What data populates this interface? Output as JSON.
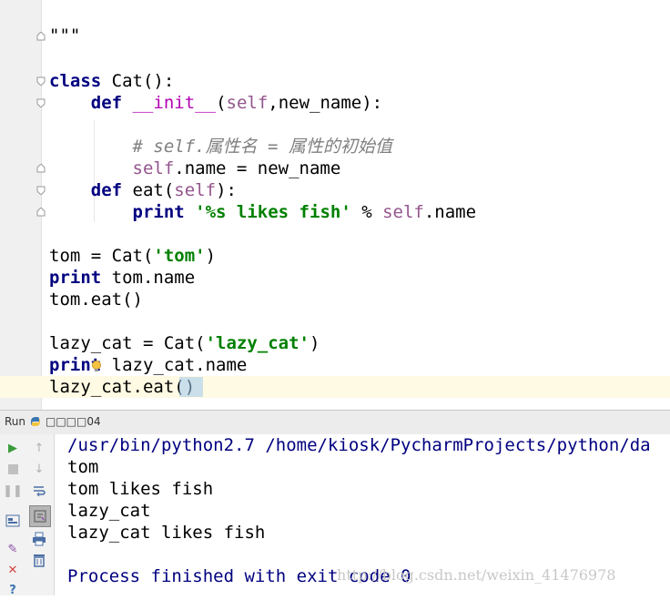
{
  "editor": {
    "lines": [
      {
        "segments": [
          {
            "t": "\"\"\"",
            "c": "plain"
          }
        ]
      },
      {
        "segments": [
          {
            "t": "class",
            "c": "kw"
          },
          {
            "t": " Cat():",
            "c": "plain"
          }
        ]
      },
      {
        "segments": [
          {
            "t": "    ",
            "c": "plain"
          },
          {
            "t": "def",
            "c": "kw"
          },
          {
            "t": " ",
            "c": "plain"
          },
          {
            "t": "__init__",
            "c": "magic"
          },
          {
            "t": "(",
            "c": "plain"
          },
          {
            "t": "self",
            "c": "self"
          },
          {
            "t": ",new_name):",
            "c": "plain"
          }
        ]
      },
      {
        "segments": [
          {
            "t": "        ",
            "c": "plain"
          },
          {
            "t": "# self.属性名 = 属性的初始值",
            "c": "cm"
          }
        ]
      },
      {
        "segments": [
          {
            "t": "        ",
            "c": "plain"
          },
          {
            "t": "self",
            "c": "self"
          },
          {
            "t": ".name = new_name",
            "c": "plain"
          }
        ]
      },
      {
        "segments": [
          {
            "t": "    ",
            "c": "plain"
          },
          {
            "t": "def",
            "c": "kw"
          },
          {
            "t": " eat(",
            "c": "plain"
          },
          {
            "t": "self",
            "c": "self"
          },
          {
            "t": "):",
            "c": "plain"
          }
        ]
      },
      {
        "segments": [
          {
            "t": "        ",
            "c": "plain"
          },
          {
            "t": "print",
            "c": "kw"
          },
          {
            "t": " ",
            "c": "plain"
          },
          {
            "t": "'%s likes fish'",
            "c": "str"
          },
          {
            "t": " % ",
            "c": "plain"
          },
          {
            "t": "self",
            "c": "self"
          },
          {
            "t": ".name",
            "c": "plain"
          }
        ]
      },
      {
        "segments": [
          {
            "t": "tom = Cat(",
            "c": "plain"
          },
          {
            "t": "'tom'",
            "c": "str"
          },
          {
            "t": ")",
            "c": "plain"
          }
        ]
      },
      {
        "segments": [
          {
            "t": "print",
            "c": "kw"
          },
          {
            "t": " tom.name",
            "c": "plain"
          }
        ]
      },
      {
        "segments": [
          {
            "t": "tom.eat()",
            "c": "plain"
          }
        ]
      },
      {
        "segments": [
          {
            "t": "lazy_cat = Cat(",
            "c": "plain"
          },
          {
            "t": "'lazy_cat'",
            "c": "str"
          },
          {
            "t": ")",
            "c": "plain"
          }
        ]
      },
      {
        "segments": [
          {
            "t": "print",
            "c": "kw"
          },
          {
            "t": " lazy_cat.name",
            "c": "plain"
          }
        ]
      },
      {
        "segments": [
          {
            "t": "lazy_cat.eat()",
            "c": "plain"
          }
        ]
      }
    ]
  },
  "run_panel": {
    "label": "Run",
    "config_name": "□□□□04",
    "output": [
      "/usr/bin/python2.7 /home/kiosk/PycharmProjects/python/da",
      "tom",
      "tom likes fish",
      "lazy_cat",
      "lazy_cat likes fish",
      "",
      "Process finished with exit code 0"
    ]
  },
  "watermark": "http://blog.csdn.net/weixin_41476978",
  "colors": {
    "keyword": "#000080",
    "string": "#008000",
    "self": "#94558d",
    "magic": "#b200b2",
    "comment": "#808080",
    "caret_line": "#fffae3"
  }
}
